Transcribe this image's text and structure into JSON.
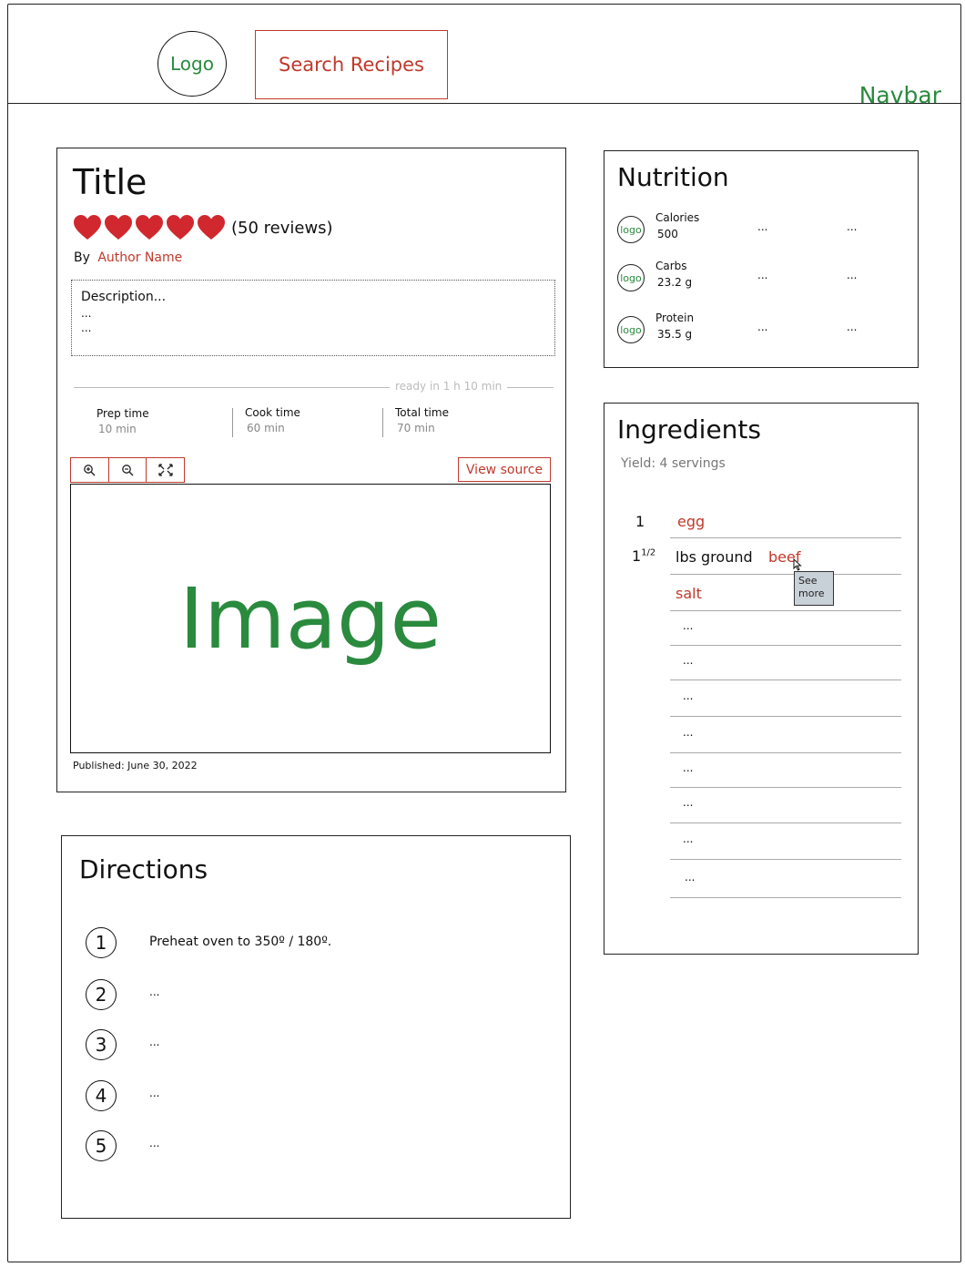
{
  "navbar": {
    "logo": "Logo",
    "search_label": "Search Recipes",
    "label": "Navbar",
    "accent_green": "#2a8a3e",
    "accent_red": "#c0392b"
  },
  "recipe": {
    "title": "Title",
    "rating": {
      "hearts": 5,
      "reviews": "(50 reviews)"
    },
    "by": "By",
    "author": "Author Name",
    "description": [
      "Description...",
      "...",
      "..."
    ],
    "ready_text": "ready in 1 h 10 min",
    "times": [
      {
        "label": "Prep time",
        "value": "10 min"
      },
      {
        "label": "Cook time",
        "value": "60 min"
      },
      {
        "label": "Total time",
        "value": "70 min"
      }
    ],
    "zoom_icons": [
      "zoom-in-icon",
      "zoom-out-icon",
      "fit-screen-icon"
    ],
    "view_source": "View source",
    "image_placeholder": "Image",
    "published": "Published: June 30, 2022"
  },
  "nutrition": {
    "heading": "Nutrition",
    "icon_label": "logo",
    "items": [
      {
        "name": "Calories",
        "value": "500",
        "col2": "...",
        "col3": "..."
      },
      {
        "name": "Carbs",
        "value": "23.2 g",
        "col2": "...",
        "col3": "..."
      },
      {
        "name": "Protein",
        "value": "35.5 g",
        "col2": "...",
        "col3": "..."
      }
    ]
  },
  "ingredients": {
    "heading": "Ingredients",
    "yield": "Yield: 4 servings",
    "items": [
      {
        "qty": "1",
        "qty_sup": "",
        "text": "",
        "link": "egg"
      },
      {
        "qty": "1",
        "qty_sup": "1/2",
        "text": "lbs ground",
        "link": "beef"
      },
      {
        "qty": "",
        "qty_sup": "",
        "text": "",
        "link": "salt"
      }
    ],
    "more_rows": [
      "...",
      "...",
      "...",
      "...",
      "...",
      "...",
      "...",
      "..."
    ],
    "tooltip": [
      "See",
      "more"
    ]
  },
  "directions": {
    "heading": "Directions",
    "steps": [
      {
        "num": "1",
        "text": "Preheat oven to 350º / 180º."
      },
      {
        "num": "2",
        "text": "..."
      },
      {
        "num": "3",
        "text": "..."
      },
      {
        "num": "4",
        "text": "..."
      },
      {
        "num": "5",
        "text": "..."
      }
    ]
  }
}
